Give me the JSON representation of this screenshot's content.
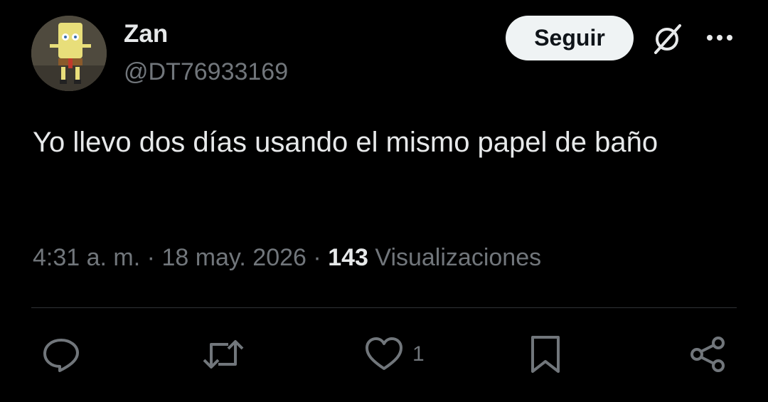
{
  "author": {
    "name": "Zan",
    "handle": "@DT76933169"
  },
  "follow_label": "Seguir",
  "tweet_text": "Yo llevo dos días usando el mismo papel de baño",
  "meta": {
    "time": "4:31 a. m.",
    "separator": "·",
    "date": "18 may. 2026",
    "views_count": "143",
    "views_label": "Visualizaciones"
  },
  "actions": {
    "like_count": "1"
  },
  "icons": {
    "grok": "grok-slash-icon",
    "more": "more-horizontal-icon",
    "reply": "reply-icon",
    "retweet": "retweet-icon",
    "like": "heart-icon",
    "bookmark": "bookmark-icon",
    "share": "share-icon"
  },
  "colors": {
    "background": "#000000",
    "primary_text": "#e7e9ea",
    "secondary_text": "#71767b",
    "follow_bg": "#eff3f4"
  }
}
